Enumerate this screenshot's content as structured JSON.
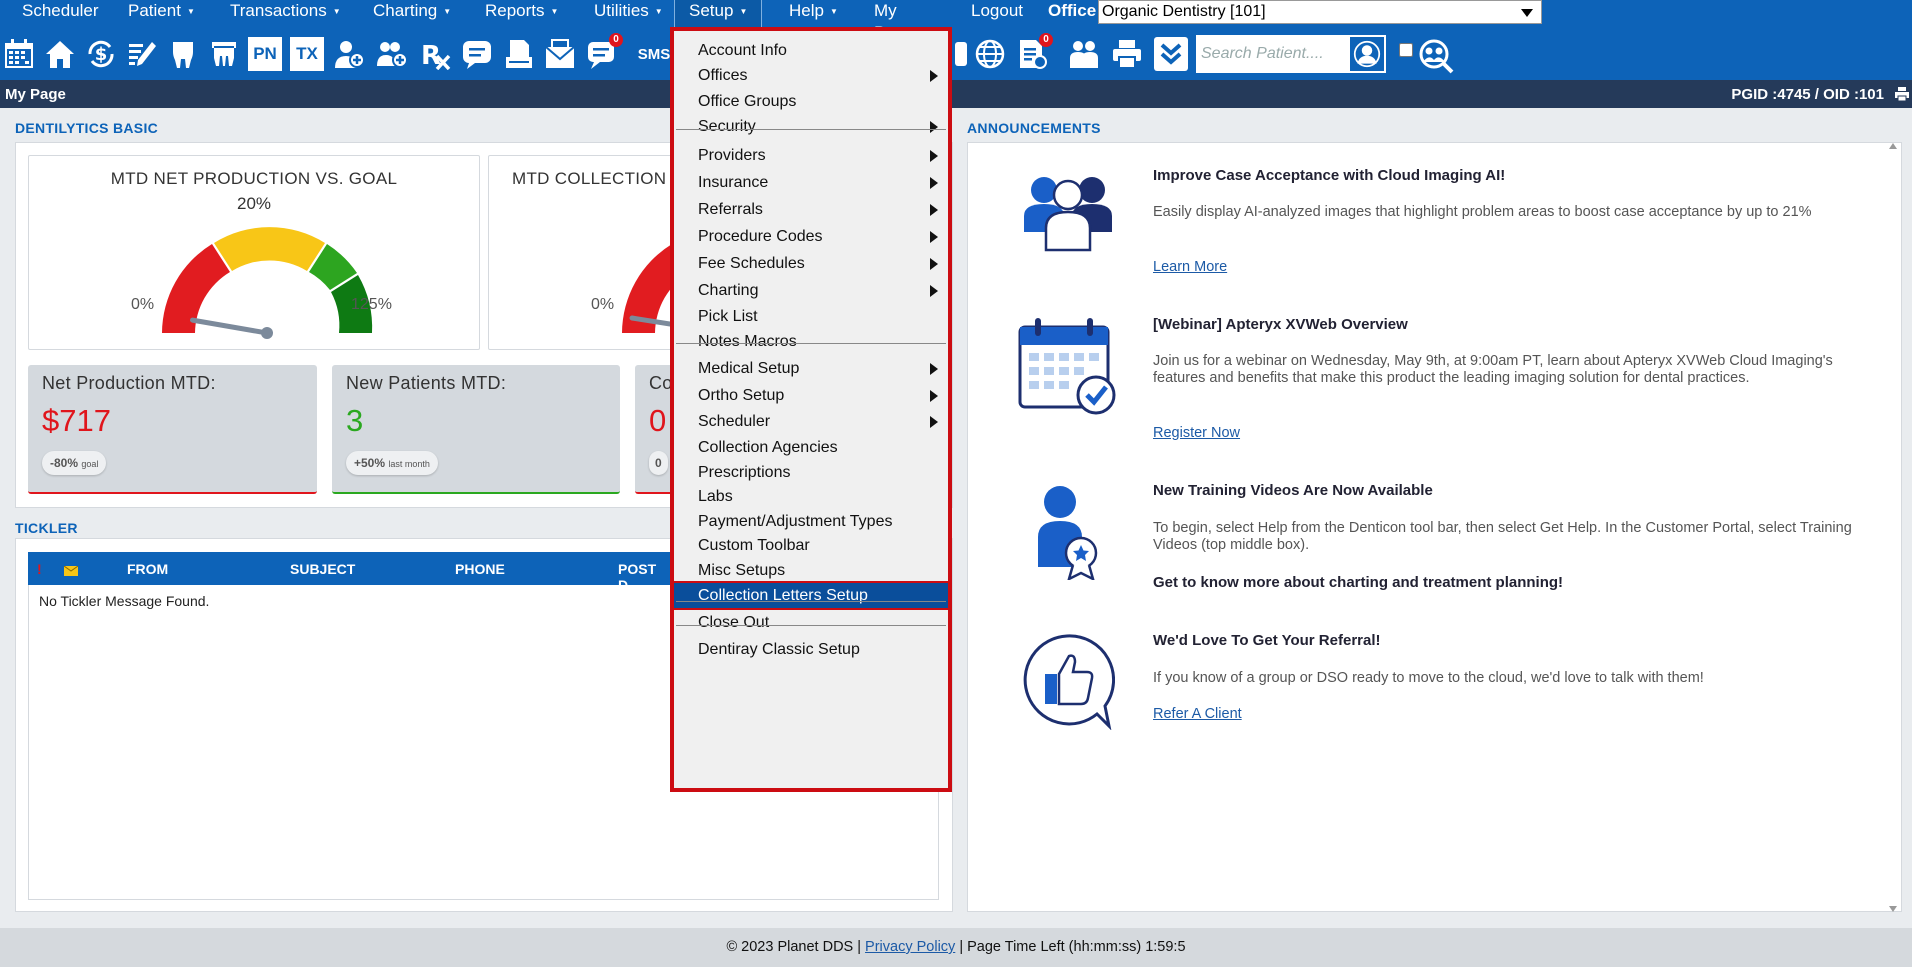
{
  "nav": {
    "items": [
      {
        "label": "Scheduler",
        "caret": false
      },
      {
        "label": "Patient",
        "caret": true
      },
      {
        "label": "Transactions",
        "caret": true
      },
      {
        "label": "Charting",
        "caret": true
      },
      {
        "label": "Reports",
        "caret": true
      },
      {
        "label": "Utilities",
        "caret": true
      },
      {
        "label": "Setup",
        "caret": true
      },
      {
        "label": "Help",
        "caret": true
      },
      {
        "label": "My Page",
        "caret": false
      },
      {
        "label": "Logout",
        "caret": false
      }
    ],
    "office_label": "Office",
    "office_value": "Organic Dentistry [101]"
  },
  "toolbar": {
    "icons": [
      "calendar-icon",
      "home-icon",
      "dollar-refresh-icon",
      "edit-notes-icon",
      "tooth-icon",
      "teeth-icon",
      "pn-icon",
      "tx-icon",
      "add-patient-icon",
      "add-family-icon",
      "rx-icon",
      "message-icon",
      "scanner-icon",
      "mail-icon",
      "chat-icon",
      "sms-icon"
    ],
    "pn_label": "PN",
    "tx_label": "TX",
    "sms_label": "SMS",
    "chat_badge": "0",
    "report_badge": "0",
    "search_placeholder": "Search Patient...."
  },
  "page": {
    "title": "My Page",
    "pgid": "PGID :4745  /  OID :101"
  },
  "dentilytics": {
    "section_title": "DENTILYTICS BASIC",
    "gauges": [
      {
        "title": "MTD NET PRODUCTION VS. GOAL",
        "value_label": "20%",
        "value_fraction": 0.16,
        "min_label": "0%",
        "max_label": "125%"
      },
      {
        "title": "MTD COLLECTION",
        "min_label": "0%"
      }
    ],
    "stats": [
      {
        "title": "Net Production MTD:",
        "value": "$717",
        "pill": "-80%",
        "pill_note": "goal",
        "color": "#e0151c"
      },
      {
        "title": "New Patients MTD:",
        "value": "3",
        "pill": "+50%",
        "pill_note": "last month",
        "color": "#2aa81f"
      },
      {
        "title": "Co",
        "value": "0",
        "pill": "0",
        "pill_note": "",
        "color": "#e0151c"
      }
    ]
  },
  "tickler": {
    "section_title": "TICKLER",
    "columns": [
      "FROM",
      "SUBJECT",
      "PHONE",
      "POST D"
    ],
    "empty_text": "No Tickler Message Found.",
    "flag_symbol": "!"
  },
  "announcements": {
    "section_title": "ANNOUNCEMENTS",
    "items": [
      {
        "title": "Improve Case Acceptance with Cloud Imaging AI!",
        "body": "Easily display AI-analyzed images that highlight problem areas to boost case acceptance by up to 21%",
        "link": "Learn More",
        "icon": "people-group-icon"
      },
      {
        "title": "[Webinar] Apteryx XVWeb Overview",
        "body": "Join us for a webinar on Wednesday, May 9th, at 9:00am PT, learn about Apteryx XVWeb Cloud Imaging's features and benefits that make this product the leading imaging solution for dental practices.",
        "link": "Register Now",
        "icon": "calendar-check-icon"
      },
      {
        "title": "New Training Videos Are Now Available",
        "body": "To begin, select Help from the Denticon tool bar, then select Get Help. In the Customer Portal, select Training Videos (top middle box).",
        "extra": "Get to know more about charting and treatment planning!",
        "icon": "user-award-icon"
      },
      {
        "title": "We'd Love To Get Your Referral!",
        "body": "If you know of a group or DSO ready to move to the cloud, we'd love to talk with them!",
        "link": "Refer A Client",
        "icon": "thumbs-up-bubble-icon"
      }
    ]
  },
  "setup_menu": {
    "items": [
      {
        "label": "Account Info",
        "submenu": false
      },
      {
        "label": "Offices",
        "submenu": true
      },
      {
        "label": "Office Groups",
        "submenu": false
      },
      {
        "label": "Security",
        "submenu": true
      },
      {
        "label": "Providers",
        "submenu": true
      },
      {
        "label": "Insurance",
        "submenu": true
      },
      {
        "label": "Referrals",
        "submenu": true
      },
      {
        "label": "Procedure Codes",
        "submenu": true
      },
      {
        "label": "Fee Schedules",
        "submenu": true
      },
      {
        "label": "Charting",
        "submenu": true
      },
      {
        "label": "Pick List",
        "submenu": false
      },
      {
        "label": "Notes Macros",
        "submenu": false
      },
      {
        "label": "Medical Setup",
        "submenu": true
      },
      {
        "label": "Ortho Setup",
        "submenu": true
      },
      {
        "label": "Scheduler",
        "submenu": true
      },
      {
        "label": "Collection Agencies",
        "submenu": false
      },
      {
        "label": "Prescriptions",
        "submenu": false
      },
      {
        "label": "Labs",
        "submenu": false
      },
      {
        "label": "Payment/Adjustment Types",
        "submenu": false
      },
      {
        "label": "Custom Toolbar",
        "submenu": false
      },
      {
        "label": "Misc Setups",
        "submenu": false
      },
      {
        "label": "Collection Letters Setup",
        "submenu": false,
        "highlighted": true
      },
      {
        "label": "Close Out",
        "submenu": false
      },
      {
        "label": "Dentiray Classic Setup",
        "submenu": false
      }
    ]
  },
  "footer": {
    "copyright": "© 2023 Planet DDS |",
    "privacy": "Privacy Policy",
    "time_left": "|  Page Time Left (hh:mm:ss) 1:59:5"
  },
  "colors": {
    "brand_blue": "#0d63b8",
    "header_navy": "#253a5a",
    "highlight_red": "#cc0c12",
    "negative_red": "#e0151c",
    "positive_green": "#2aa81f"
  }
}
